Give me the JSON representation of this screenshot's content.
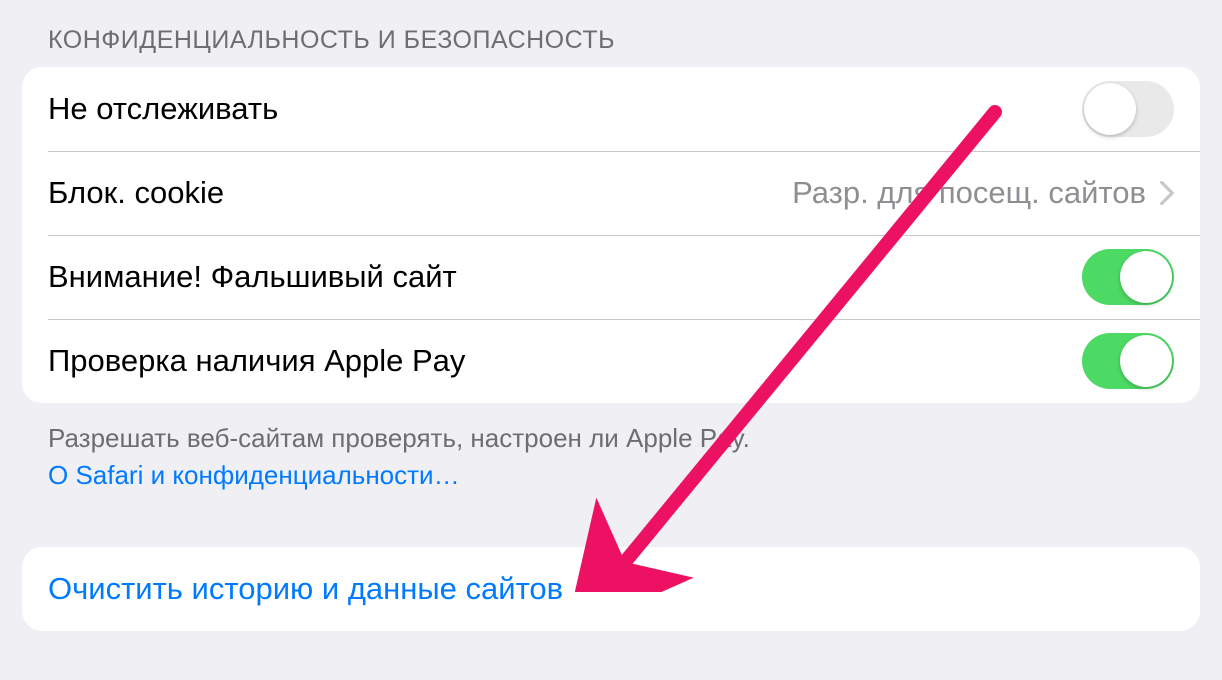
{
  "section": {
    "header": "КОНФИДЕНЦИАЛЬНОСТЬ И БЕЗОПАСНОСТЬ",
    "rows": [
      {
        "label": "Не отслеживать",
        "kind": "toggle",
        "on": false
      },
      {
        "label": "Блок. cookie",
        "kind": "link",
        "value": "Разр. для посещ. сайтов"
      },
      {
        "label": "Внимание! Фальшивый сайт",
        "kind": "toggle",
        "on": true
      },
      {
        "label": "Проверка наличия Apple Pay",
        "kind": "toggle",
        "on": true
      }
    ],
    "footer": {
      "text": "Разрешать веб-сайтам проверять, настроен ли Apple Pay.",
      "link": "О Safari и конфиденциальности…"
    }
  },
  "action": {
    "label": "Очистить историю и данные сайтов"
  },
  "colors": {
    "accent": "#007aff",
    "toggle_on": "#4cd964",
    "arrow": "#ec1163"
  }
}
